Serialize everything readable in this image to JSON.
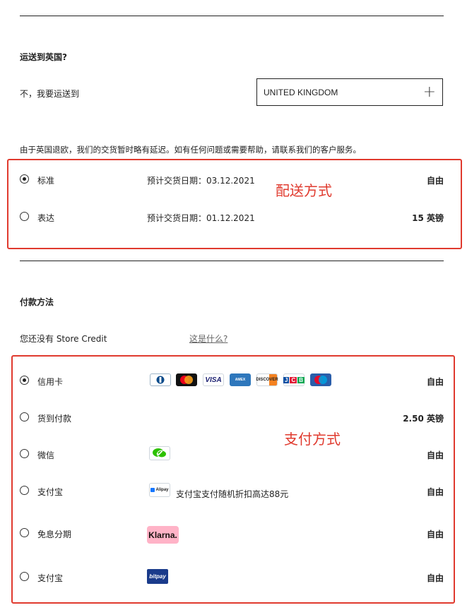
{
  "shipping": {
    "question": "运送到英国?",
    "prompt": "不，我要运送到",
    "country_value": "UNITED KINGDOM",
    "notice": "由于英国退欧，我们的交货暂时略有延迟。如有任何问题或需要帮助，请联系我们的客户服务。",
    "options": [
      {
        "label": "标准",
        "delivery": "预计交货日期：03.12.2021",
        "price": "自由",
        "selected": true
      },
      {
        "label": "表达",
        "delivery": "预计交货日期：01.12.2021",
        "price": "15 英镑",
        "selected": false
      }
    ],
    "annotation": "配送方式"
  },
  "payment": {
    "title": "付款方法",
    "store_credit": "您还没有 Store Credit",
    "what_is_this": "这是什么?",
    "card_logos": [
      "Diners",
      "Mastercard",
      "VISA",
      "AmEx",
      "Discover",
      "JCB",
      "Maestro"
    ],
    "options": [
      {
        "label": "信用卡",
        "price": "自由",
        "selected": true
      },
      {
        "label": "货到付款",
        "price": "2.50 英镑",
        "selected": false
      },
      {
        "label": "微信",
        "price": "自由",
        "selected": false
      },
      {
        "label": "支付宝",
        "price": "自由",
        "promo": "支付宝支付随机折扣高达88元",
        "badge": "Alipay",
        "selected": false
      },
      {
        "label": "免息分期",
        "price": "自由",
        "badge": "Klarna.",
        "selected": false
      },
      {
        "label": "支付宝",
        "price": "自由",
        "badge": "bitpay",
        "selected": false
      }
    ],
    "annotation": "支付方式"
  },
  "colors": {
    "annotation": "#e03a2e",
    "klarna": "#ffb3c7",
    "bitpay": "#1a3b8b",
    "wechat": "#2dc100"
  }
}
